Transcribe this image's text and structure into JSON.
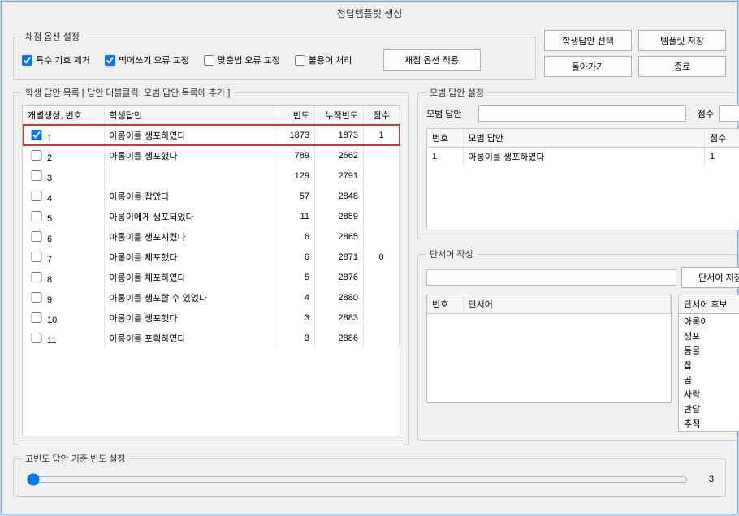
{
  "title": "정답템플릿 생성",
  "groups": {
    "options": "채점 옵션 설정",
    "student_list": "학생 답안 목록 [ 답안 더블클릭: 모범 답안 목록에 추가 ]",
    "model_answer": "모범 답안 설정",
    "clue": "단서어 작성",
    "freq": "고빈도 답안 기준 빈도 설정"
  },
  "options": {
    "remove_special": "특수 기호 제거",
    "spacing": "띄어쓰기 오류 교정",
    "spelling": "맞춤법 오류 교정",
    "stopword": "불용어 처리",
    "apply": "채점 옵션 적용"
  },
  "buttons": {
    "select_student": "학생답안 선택",
    "save_template": "템플릿 저장",
    "back": "돌아가기",
    "exit": "종료",
    "save_clue": "단서어 저장"
  },
  "student_cols": {
    "gen_no": "개별생성, 번호",
    "answer": "학생답안",
    "freq": "빈도",
    "cum": "누적빈도",
    "score": "점수"
  },
  "student_rows": [
    {
      "chk": true,
      "no": "1",
      "ans": "아롱이를 생포하였다",
      "freq": "1873",
      "cum": "1873",
      "score": "1",
      "hl": true
    },
    {
      "chk": false,
      "no": "2",
      "ans": "아롱이를 생포했다",
      "freq": "789",
      "cum": "2662",
      "score": ""
    },
    {
      "chk": false,
      "no": "3",
      "ans": "",
      "freq": "129",
      "cum": "2791",
      "score": ""
    },
    {
      "chk": false,
      "no": "4",
      "ans": "아롱이를 잡았다",
      "freq": "57",
      "cum": "2848",
      "score": ""
    },
    {
      "chk": false,
      "no": "5",
      "ans": "아롱이에게 생포되었다",
      "freq": "11",
      "cum": "2859",
      "score": ""
    },
    {
      "chk": false,
      "no": "6",
      "ans": "아롱이를 생포시켰다",
      "freq": "6",
      "cum": "2865",
      "score": ""
    },
    {
      "chk": false,
      "no": "7",
      "ans": "아롱이를 체포했다",
      "freq": "6",
      "cum": "2871",
      "score": "0"
    },
    {
      "chk": false,
      "no": "8",
      "ans": "아롱이를 체포하였다",
      "freq": "5",
      "cum": "2876",
      "score": ""
    },
    {
      "chk": false,
      "no": "9",
      "ans": "아롱이를 생포할 수 있었다",
      "freq": "4",
      "cum": "2880",
      "score": ""
    },
    {
      "chk": false,
      "no": "10",
      "ans": "아롱이를 생포햇다",
      "freq": "3",
      "cum": "2883",
      "score": ""
    },
    {
      "chk": false,
      "no": "11",
      "ans": "아롱이를 포획하였다",
      "freq": "3",
      "cum": "2886",
      "score": ""
    }
  ],
  "model": {
    "label_answer": "모범 답안",
    "label_score": "점수",
    "input_answer": "",
    "input_score": "",
    "cols": {
      "no": "번호",
      "ans": "모범 답안",
      "score": "점수"
    },
    "rows": [
      {
        "no": "1",
        "ans": "아롱이를 생포하였다",
        "score": "1"
      }
    ]
  },
  "clue": {
    "input": "",
    "cols": {
      "no": "번호",
      "word": "단서어"
    },
    "cand_label": "단서어 후보",
    "candidates": [
      "아롱이",
      "생포",
      "동물",
      "잡",
      "곱",
      "사람",
      "반달",
      "추적"
    ],
    "chevron": "^"
  },
  "slider": {
    "value": "3"
  }
}
